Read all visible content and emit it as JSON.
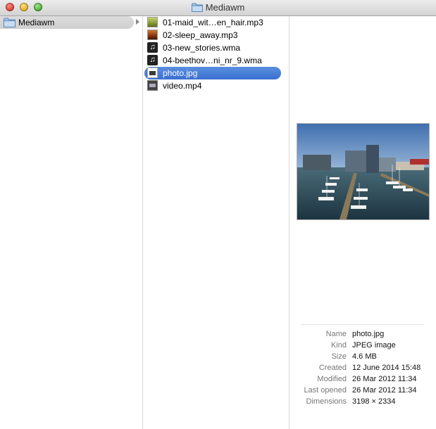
{
  "window": {
    "title": "Mediawm"
  },
  "sidebar": {
    "items": [
      {
        "label": "Mediawm"
      }
    ]
  },
  "files": [
    {
      "name": "01-maid_wit…en_hair.mp3",
      "icon": "album-art-green-icon",
      "selected": false
    },
    {
      "name": "02-sleep_away.mp3",
      "icon": "album-art-brown-icon",
      "selected": false
    },
    {
      "name": "03-new_stories.wma",
      "icon": "music-note-icon",
      "selected": false
    },
    {
      "name": "04-beethov…ni_nr_9.wma",
      "icon": "music-note-icon",
      "selected": false
    },
    {
      "name": "photo.jpg",
      "icon": "image-file-icon",
      "selected": true
    },
    {
      "name": "video.mp4",
      "icon": "video-file-icon",
      "selected": false
    }
  ],
  "preview": {
    "info": [
      {
        "key": "Name",
        "value": "photo.jpg"
      },
      {
        "key": "Kind",
        "value": "JPEG image"
      },
      {
        "key": "Size",
        "value": "4.6 MB"
      },
      {
        "key": "Created",
        "value": "12 June 2014 15:48"
      },
      {
        "key": "Modified",
        "value": "26 Mar 2012 11:34"
      },
      {
        "key": "Last opened",
        "value": "26 Mar 2012 11:34"
      },
      {
        "key": "Dimensions",
        "value": "3198 × 2334"
      }
    ]
  },
  "colors": {
    "selection": "#3a6fd0",
    "titlebar": "#dcdcdc"
  }
}
